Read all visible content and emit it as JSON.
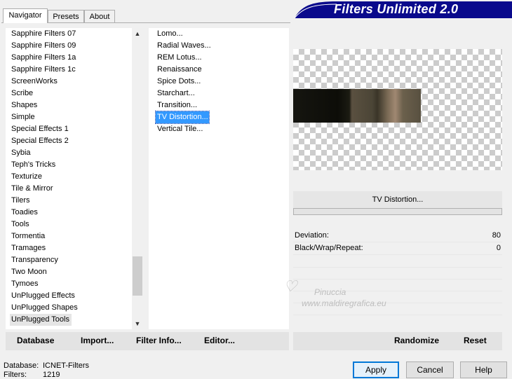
{
  "tabs": [
    {
      "label": "Navigator"
    },
    {
      "label": "Presets"
    },
    {
      "label": "About"
    }
  ],
  "banner": {
    "title": "Filters Unlimited 2.0",
    "color": "#0a0a8c"
  },
  "categories": [
    "Sapphire Filters 07",
    "Sapphire Filters 09",
    "Sapphire Filters 1a",
    "Sapphire Filters 1c",
    "ScreenWorks",
    "Scribe",
    "Shapes",
    "Simple",
    "Special Effects 1",
    "Special Effects 2",
    "Sybia",
    "Teph's Tricks",
    "Texturize",
    "Tile & Mirror",
    "Tilers",
    "Toadies",
    "Tools",
    "Tormentia",
    "Tramages",
    "Transparency",
    "Two Moon",
    "Tymoes",
    "UnPlugged Effects",
    "UnPlugged Shapes",
    "UnPlugged Tools"
  ],
  "category_selected": "UnPlugged Tools",
  "filters": [
    "Lomo...",
    "Radial Waves...",
    "REM Lotus...",
    "Renaissance",
    "Spice Dots...",
    "Starchart...",
    "Transition...",
    "TV Distortion...",
    "Vertical Tile..."
  ],
  "filter_selected": "TV Distortion...",
  "filter_name": "TV Distortion...",
  "controls": [
    {
      "label": "Deviation:",
      "value": "80"
    },
    {
      "label": "Black/Wrap/Repeat:",
      "value": "0"
    }
  ],
  "bottom_left": {
    "database": "Database",
    "import": "Import...",
    "filter_info": "Filter Info...",
    "editor": "Editor..."
  },
  "bottom_right": {
    "randomize": "Randomize",
    "reset": "Reset"
  },
  "status": {
    "database_label": "Database:",
    "database_value": "ICNET-Filters",
    "filters_label": "Filters:",
    "filters_value": "1219"
  },
  "buttons": {
    "apply": "Apply",
    "cancel": "Cancel",
    "help": "Help"
  },
  "watermark": {
    "line1": "Pinuccia",
    "line2": "www.maldiregrafica.eu"
  },
  "colors": {
    "selection": "#3399ff",
    "banner": "#0a0a8c",
    "default_button_border": "#0078d7"
  }
}
